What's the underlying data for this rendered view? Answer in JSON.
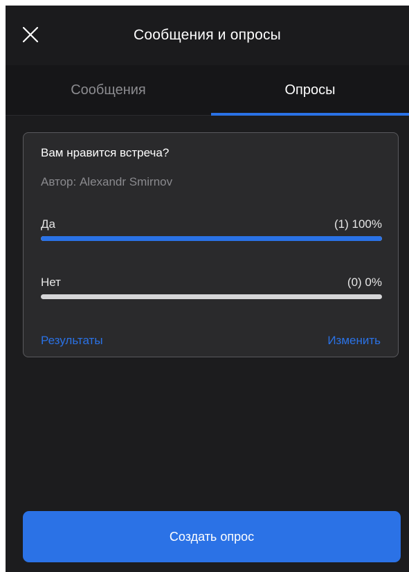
{
  "header": {
    "title": "Сообщения и опросы",
    "close_icon": "close-icon"
  },
  "tabs": [
    {
      "label": "Сообщения",
      "active": false
    },
    {
      "label": "Опросы",
      "active": true
    }
  ],
  "poll": {
    "question": "Вам нравится встреча?",
    "author": "Автор: Alexandr Smirnov",
    "options": [
      {
        "label": "Да",
        "result": "(1) 100%",
        "votes": 1,
        "percent": 100
      },
      {
        "label": "Нет",
        "result": "(0) 0%",
        "votes": 0,
        "percent": 0
      }
    ],
    "results_link": "Результаты",
    "edit_link": "Изменить"
  },
  "create_button": {
    "label": "Создать опрос"
  },
  "colors": {
    "accent": "#2a72e6",
    "background": "#1c1c1e",
    "card": "#2a2a2c",
    "muted_text": "#8c8c90"
  }
}
